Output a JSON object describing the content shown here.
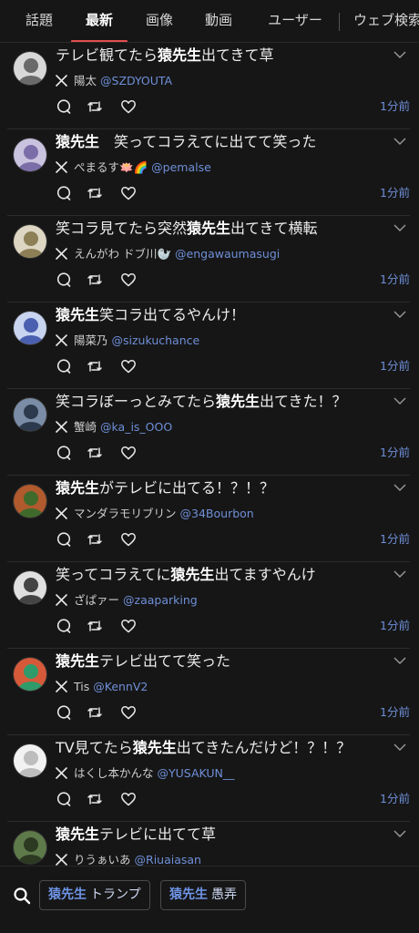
{
  "tabs": [
    "話題",
    "最新",
    "画像",
    "動画",
    "ユーザー",
    "ウェブ検索"
  ],
  "active_tab": 1,
  "tweets": [
    {
      "pre": "テレビ観てたら",
      "kw": "猿先生",
      "post": "出てきて草",
      "name": "陽太",
      "handle": "@SZDYOUTA",
      "time": "1分前",
      "avatar_colors": [
        "#d8d8d8",
        "#6a6a6a"
      ]
    },
    {
      "pre": "",
      "kw": "猿先生",
      "post": "　笑ってコラえてに出てて笑った",
      "name": "ぺまるす🪷🌈",
      "handle": "@pemalse",
      "time": "1分前",
      "avatar_colors": [
        "#c9c3df",
        "#7b6ea8"
      ]
    },
    {
      "pre": "笑コラ見てたら突然",
      "kw": "猿先生",
      "post": "出てきて横転",
      "name": "えんがわ ドブ川🦭",
      "handle": "@engawaumasugi",
      "time": "1分前",
      "avatar_colors": [
        "#dcd6c2",
        "#8d7f56"
      ]
    },
    {
      "pre": "",
      "kw": "猿先生",
      "post": "笑コラ出てるやんけ！",
      "name": "陽菜乃",
      "handle": "@sizukuchance",
      "time": "1分前",
      "avatar_colors": [
        "#c8d4f0",
        "#4b5fb0"
      ]
    },
    {
      "pre": "笑コラぼーっとみてたら",
      "kw": "猿先生",
      "post": "出てきた！？",
      "name": "蟹崎",
      "handle": "@ka_is_OOO",
      "time": "1分前",
      "avatar_colors": [
        "#7b8da6",
        "#2d3a4d"
      ]
    },
    {
      "pre": "",
      "kw": "猿先生",
      "post": "がテレビに出てる！？！？",
      "name": "マンダラモリブリン",
      "handle": "@34Bourbon",
      "time": "1分前",
      "avatar_colors": [
        "#b05a2e",
        "#3f6a2c"
      ]
    },
    {
      "pre": "笑ってコラえてに",
      "kw": "猿先生",
      "post": "出てますやんけ",
      "name": "ざぱァー",
      "handle": "@zaaparking",
      "time": "1分前",
      "avatar_colors": [
        "#e0e0e0",
        "#444444"
      ]
    },
    {
      "pre": "",
      "kw": "猿先生",
      "post": "テレビ出てて笑った",
      "name": "Tis",
      "handle": "@KennV2",
      "time": "1分前",
      "avatar_colors": [
        "#d65a3a",
        "#2f9a6a"
      ]
    },
    {
      "pre": "TV見てたら",
      "kw": "猿先生",
      "post": "出てきたんだけど！？！？",
      "name": "はくし本かんな",
      "handle": "@YUSAKUN__",
      "time": "1分前",
      "avatar_colors": [
        "#f2f2f2",
        "#bdbdbd"
      ]
    },
    {
      "pre": "",
      "kw": "猿先生",
      "post": "テレビに出てて草",
      "name": "りうぁいあ",
      "handle": "@Riuaiasan",
      "time": "",
      "avatar_colors": [
        "#5f7a4a",
        "#2c3a22"
      ]
    }
  ],
  "footer": {
    "chips": [
      {
        "kw": "猿先生",
        "rest": "トランプ"
      },
      {
        "kw": "猿先生",
        "rest": "愚弄"
      }
    ]
  },
  "colors": {
    "accent_red": "#e24d4d",
    "link_blue": "#6f8fd8",
    "background": "#161616"
  },
  "icons": [
    "x-logo-icon",
    "reply-icon",
    "retweet-icon",
    "like-icon",
    "chevron-down-icon",
    "search-icon"
  ]
}
